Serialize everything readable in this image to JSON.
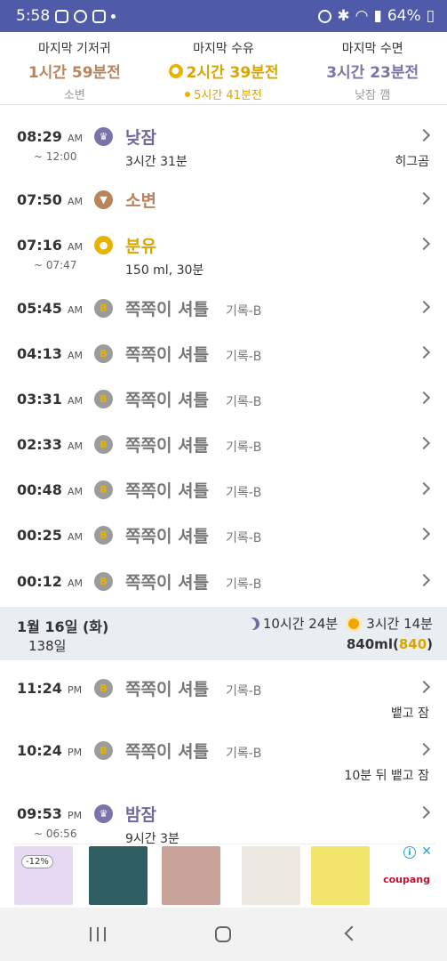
{
  "status_bar": {
    "time": "5:58",
    "battery": "64%"
  },
  "summary": {
    "diaper": {
      "label": "마지막 기저귀",
      "value": "1시간 59분전",
      "sub": "소변"
    },
    "feed": {
      "label": "마지막 수유",
      "value": "2시간 39분전",
      "sub": "5시간 41분전"
    },
    "sleep": {
      "label": "마지막 수면",
      "value": "3시간 23분전",
      "sub": "낮잠 깸"
    }
  },
  "events_today": [
    {
      "time": "08:29",
      "ampm": "AM",
      "end": "~ 12:00",
      "icon": "nap-icon",
      "title": "낮잠",
      "detail": "3시간 31분",
      "right": "히그곰",
      "tag": ""
    },
    {
      "time": "07:50",
      "ampm": "AM",
      "end": "",
      "icon": "pee-icon",
      "title": "소변",
      "detail": "",
      "right": "",
      "tag": ""
    },
    {
      "time": "07:16",
      "ampm": "AM",
      "end": "~ 07:47",
      "icon": "bottle-icon",
      "title": "분유",
      "detail": "150 ml, 30분",
      "right": "",
      "tag": ""
    },
    {
      "time": "05:45",
      "ampm": "AM",
      "end": "",
      "icon": "b-icon",
      "title": "쪽쪽이 셔틀",
      "detail": "",
      "right": "",
      "tag": "기록-B"
    },
    {
      "time": "04:13",
      "ampm": "AM",
      "end": "",
      "icon": "b-icon",
      "title": "쪽쪽이 셔틀",
      "detail": "",
      "right": "",
      "tag": "기록-B"
    },
    {
      "time": "03:31",
      "ampm": "AM",
      "end": "",
      "icon": "b-icon",
      "title": "쪽쪽이 셔틀",
      "detail": "",
      "right": "",
      "tag": "기록-B"
    },
    {
      "time": "02:33",
      "ampm": "AM",
      "end": "",
      "icon": "b-icon",
      "title": "쪽쪽이 셔틀",
      "detail": "",
      "right": "",
      "tag": "기록-B"
    },
    {
      "time": "00:48",
      "ampm": "AM",
      "end": "",
      "icon": "b-icon",
      "title": "쪽쪽이 셔틀",
      "detail": "",
      "right": "",
      "tag": "기록-B"
    },
    {
      "time": "00:25",
      "ampm": "AM",
      "end": "",
      "icon": "b-icon",
      "title": "쪽쪽이 셔틀",
      "detail": "",
      "right": "",
      "tag": "기록-B"
    },
    {
      "time": "00:12",
      "ampm": "AM",
      "end": "",
      "icon": "b-icon",
      "title": "쪽쪽이 셔틀",
      "detail": "",
      "right": "",
      "tag": "기록-B"
    }
  ],
  "day_header": {
    "date": "1월 16일 (화)",
    "days_old": "138일",
    "night_sleep": "10시간 24분",
    "day_sleep": "3시간 14분",
    "ml_total": "840ml",
    "ml_highlight": "840"
  },
  "events_prev": [
    {
      "time": "11:24",
      "ampm": "PM",
      "end": "",
      "icon": "b-icon",
      "title": "쪽쪽이 셔틀",
      "detail": "",
      "right": "뱉고 잠",
      "tag": "기록-B"
    },
    {
      "time": "10:24",
      "ampm": "PM",
      "end": "",
      "icon": "b-icon",
      "title": "쪽쪽이 셔틀",
      "detail": "",
      "right": "10분 뒤 뱉고 잠",
      "tag": "기록-B"
    },
    {
      "time": "09:53",
      "ampm": "PM",
      "end": "~ 06:56",
      "icon": "nap-icon",
      "title": "밤잠",
      "detail": "9시간 3분",
      "right": "",
      "tag": ""
    }
  ],
  "ad": {
    "discount": "-12%",
    "brand": "coupang",
    "info_icon": "info-icon",
    "close_icon": "close-icon"
  }
}
